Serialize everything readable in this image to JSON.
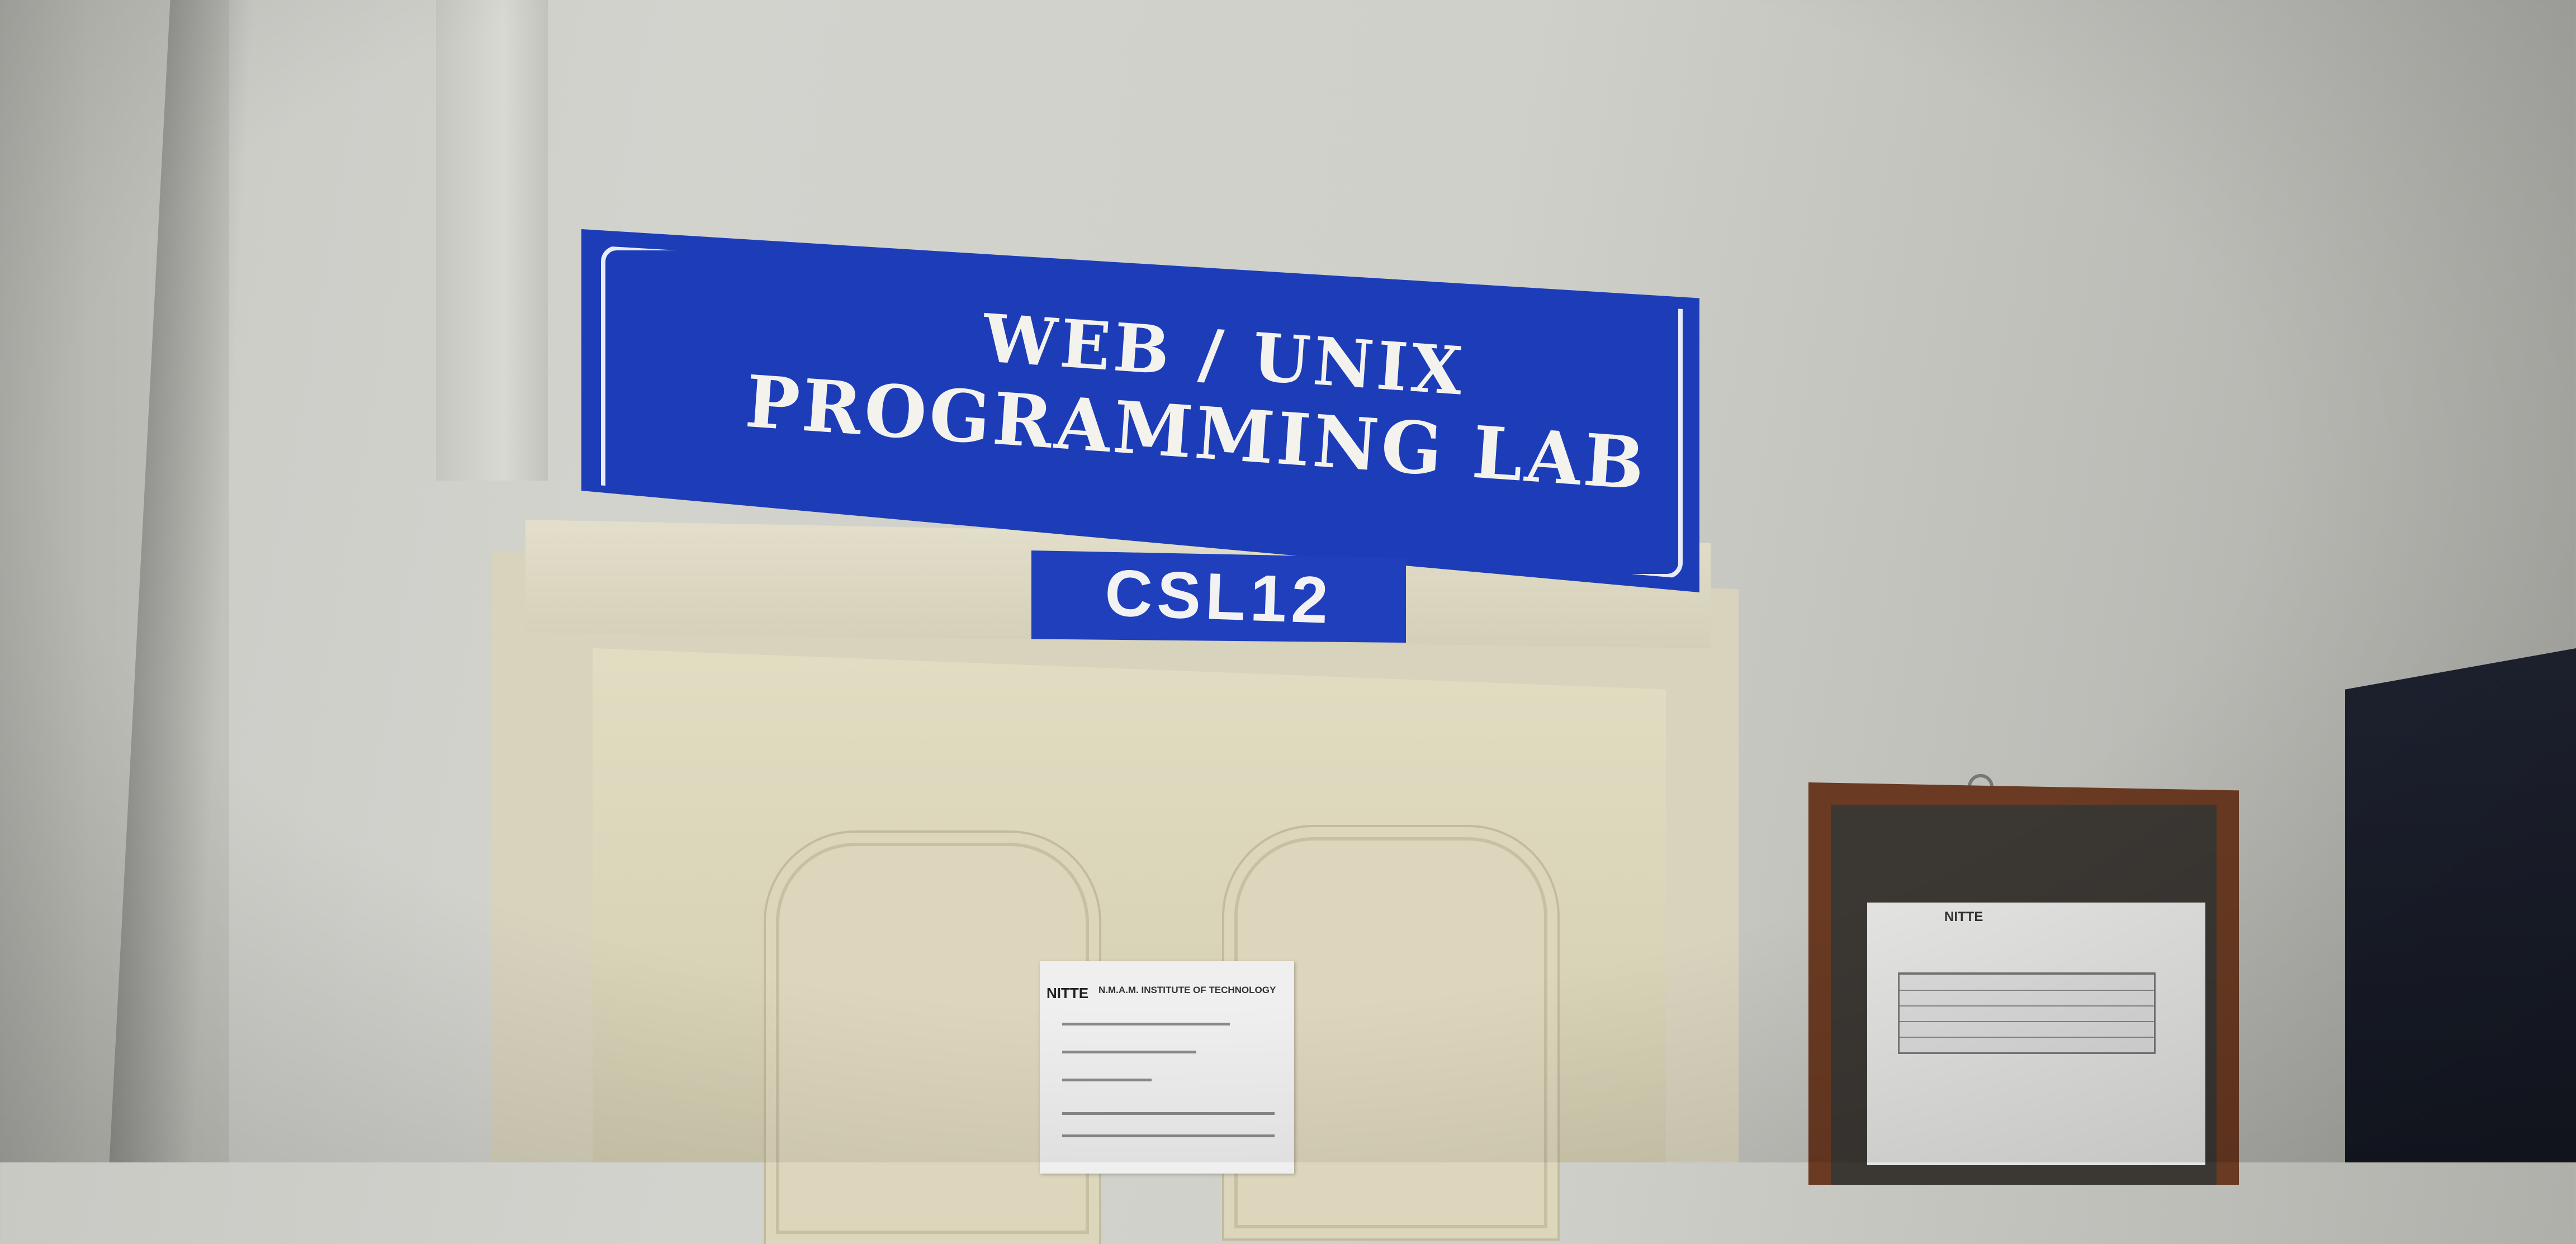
{
  "sign": {
    "line1": "WEB / UNIX",
    "line2": "PROGRAMMING LAB"
  },
  "room_plate": {
    "number": "CSL12"
  },
  "door_notice": {
    "logo": "NITTE",
    "institution": "N.M.A.M. INSTITUTE OF TECHNOLOGY"
  },
  "board_notice": {
    "logo": "NITTE"
  },
  "colors": {
    "sign_blue": "#1d3db8",
    "sign_text": "#f4f2ec",
    "wall": "#d0d0ca",
    "door": "#e2dcc2",
    "board_frame": "#6a3a22"
  }
}
